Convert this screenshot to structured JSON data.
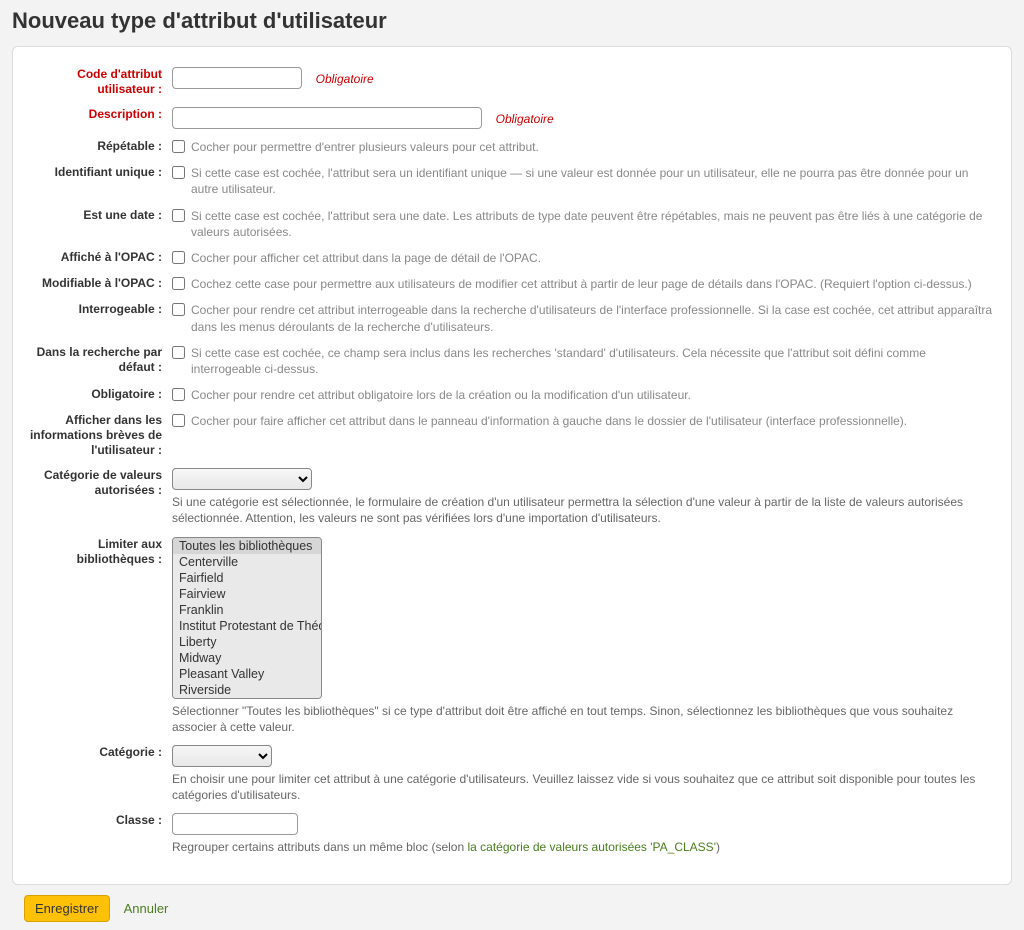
{
  "page_title": "Nouveau type d'attribut d'utilisateur",
  "required_label": "Obligatoire",
  "fields": {
    "code": {
      "label": "Code d'attribut utilisateur :"
    },
    "description": {
      "label": "Description :"
    },
    "repeatable": {
      "label": "Répétable :",
      "hint": "Cocher pour permettre d'entrer plusieurs valeurs pour cet attribut."
    },
    "unique": {
      "label": "Identifiant unique :",
      "hint": "Si cette case est cochée, l'attribut sera un identifiant unique — si une valeur est donnée pour un utilisateur, elle ne pourra pas être donnée pour un autre utilisateur."
    },
    "is_date": {
      "label": "Est une date :",
      "hint": "Si cette case est cochée, l'attribut sera une date. Les attributs de type date peuvent être répétables, mais ne peuvent pas être liés à une catégorie de valeurs autorisées."
    },
    "opac_display": {
      "label": "Affiché à l'OPAC :",
      "hint": "Cocher pour afficher cet attribut dans la page de détail de l'OPAC."
    },
    "opac_editable": {
      "label": "Modifiable à l'OPAC :",
      "hint": "Cochez cette case pour permettre aux utilisateurs de modifier cet attribut à partir de leur page de détails dans l'OPAC. (Requiert l'option ci-dessus.)"
    },
    "searchable": {
      "label": "Interrogeable :",
      "hint": "Cocher pour rendre cet attribut interrogeable dans la recherche d'utilisateurs de l'interface professionnelle. Si la case est cochée, cet attribut apparaîtra dans les menus déroulants de la recherche d'utilisateurs."
    },
    "default_search": {
      "label": "Dans la recherche par défaut :",
      "hint": "Si cette case est cochée, ce champ sera inclus dans les recherches 'standard' d'utilisateurs. Cela nécessite que l'attribut soit défini comme interrogeable ci-dessus."
    },
    "mandatory": {
      "label": "Obligatoire :",
      "hint": "Cocher pour rendre cet attribut obligatoire lors de la création ou la modification d'un utilisateur."
    },
    "brief": {
      "label": "Afficher dans les informations brèves de l'utilisateur :",
      "hint": "Cocher pour faire afficher cet attribut dans le panneau d'information à gauche dans le dossier de l'utilisateur (interface professionnelle)."
    },
    "av_category": {
      "label": "Catégorie de valeurs autorisées :",
      "hint": "Si une catégorie est sélectionnée, le formulaire de création d'un utilisateur permettra la sélection d'une valeur à partir de la liste de valeurs autorisées sélectionnée. Attention, les valeurs ne sont pas vérifiées lors d'une importation d'utilisateurs."
    },
    "libraries": {
      "label": "Limiter aux bibliothèques :",
      "options": [
        "Toutes les bibliothèques",
        "Centerville",
        "Fairfield",
        "Fairview",
        "Franklin",
        "Institut Protestant de Théologie",
        "Liberty",
        "Midway",
        "Pleasant Valley",
        "Riverside"
      ],
      "hint": "Sélectionner \"Toutes les bibliothèques\" si ce type d'attribut doit être affiché en tout temps. Sinon, sélectionnez les bibliothèques que vous souhaitez associer à cette valeur."
    },
    "category": {
      "label": "Catégorie :",
      "hint": "En choisir une pour limiter cet attribut à une catégorie d'utilisateurs. Veuillez laissez vide si vous souhaitez que ce attribut soit disponible pour toutes les catégories d'utilisateurs."
    },
    "class": {
      "label": "Classe :",
      "hint_prefix": "Regrouper certains attributs dans un même bloc (selon ",
      "hint_link": "la catégorie de valeurs autorisées 'PA_CLASS'",
      "hint_suffix": ")"
    }
  },
  "actions": {
    "save": "Enregistrer",
    "cancel": "Annuler"
  }
}
